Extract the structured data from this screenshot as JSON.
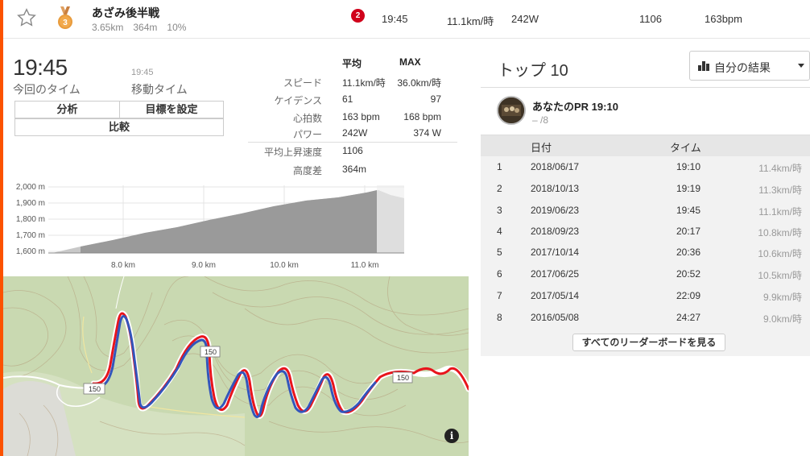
{
  "header": {
    "segment_name": "あざみ後半戦",
    "distance": "3.65km",
    "elevation_gain": "364m",
    "grade": "10%",
    "medal_rank": "3",
    "rank_badge": "2",
    "time": "19:45",
    "speed": "11.1km/時",
    "power": "242W",
    "vam": "1106",
    "heart_rate": "163bpm"
  },
  "summary": {
    "elapsed_time": "19:45",
    "elapsed_label": "今回のタイム",
    "moving_time": "19:45",
    "moving_label": "移動タイム",
    "analyze_button": "分析",
    "set_goal_button": "目標を設定",
    "compare_button": "比較"
  },
  "stats": {
    "col_avg": "平均",
    "col_max": "MAX",
    "rows": [
      {
        "label": "スピード",
        "avg": "11.1km/時",
        "max": "36.0km/時"
      },
      {
        "label": "ケイデンス",
        "avg": "61",
        "max": "97"
      },
      {
        "label": "心拍数",
        "avg": "163 bpm",
        "max": "168 bpm"
      },
      {
        "label": "パワー",
        "avg": "242W",
        "max": "374 W"
      },
      {
        "label": "平均上昇速度",
        "avg": "1106",
        "max": ""
      },
      {
        "label": "高度差",
        "avg": "364m",
        "max": ""
      }
    ]
  },
  "elevation_chart": {
    "y_ticks": [
      "2,000 m",
      "1,900 m",
      "1,800 m",
      "1,700 m",
      "1,600 m"
    ],
    "x_ticks": [
      "8.0 km",
      "9.0 km",
      "10.0 km",
      "11.0 km"
    ]
  },
  "map": {
    "labels": [
      "150",
      "150",
      "150"
    ],
    "info_icon": "i"
  },
  "top10": {
    "title": "トップ 10",
    "results_dropdown": "自分の結果",
    "pr_label": "あなたのPR 19:10",
    "pr_rank": "– /8",
    "col_date": "日付",
    "col_time": "タイム",
    "rows": [
      {
        "rank": "1",
        "date": "2018/06/17",
        "time": "19:10",
        "pace": "11.4km/時"
      },
      {
        "rank": "2",
        "date": "2018/10/13",
        "time": "19:19",
        "pace": "11.3km/時"
      },
      {
        "rank": "3",
        "date": "2019/06/23",
        "time": "19:45",
        "pace": "11.1km/時"
      },
      {
        "rank": "4",
        "date": "2018/09/23",
        "time": "20:17",
        "pace": "10.8km/時"
      },
      {
        "rank": "5",
        "date": "2017/10/14",
        "time": "20:36",
        "pace": "10.6km/時"
      },
      {
        "rank": "6",
        "date": "2017/06/25",
        "time": "20:52",
        "pace": "10.5km/時"
      },
      {
        "rank": "7",
        "date": "2017/05/14",
        "time": "22:09",
        "pace": "9.9km/時"
      },
      {
        "rank": "8",
        "date": "2016/05/08",
        "time": "24:27",
        "pace": "9.0km/時"
      }
    ],
    "view_all_button": "すべてのリーダーボードを見る"
  },
  "colors": {
    "accent": "#fc5200",
    "badge": "#d0021b",
    "route_blue": "#3355bb",
    "route_red": "#e8141c"
  }
}
